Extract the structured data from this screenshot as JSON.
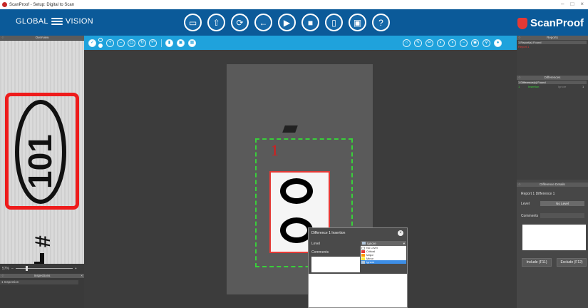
{
  "window": {
    "title": "ScanProof - Setup: Digital to Scan"
  },
  "toolbar": {
    "brand": "GLOBAL",
    "brand2": "VISION",
    "product": "ScanProof",
    "buttons": [
      {
        "icon": "folder-icon",
        "glyph": "▭"
      },
      {
        "icon": "upload-icon",
        "glyph": "⇧"
      },
      {
        "icon": "refresh-icon",
        "glyph": "⟳"
      },
      {
        "icon": "back-icon",
        "glyph": "←"
      },
      {
        "icon": "play-icon",
        "glyph": "▶"
      },
      {
        "icon": "stop-icon",
        "glyph": "■"
      },
      {
        "icon": "document-icon",
        "glyph": "▯"
      },
      {
        "icon": "screens-icon",
        "glyph": "▣"
      },
      {
        "icon": "help-icon",
        "glyph": "?"
      }
    ]
  },
  "overview": {
    "title": "Overview",
    "zoom": "57%"
  },
  "inspections": {
    "title": "Inspections",
    "item": "1 Inspection"
  },
  "viewer": {
    "difference_number": "1"
  },
  "popup": {
    "title": "Difference 1 Insertion",
    "level_label": "Level",
    "level_value": "Ignore",
    "comments_label": "Comments",
    "options": [
      {
        "label": "No Level",
        "color": "#ffffff"
      },
      {
        "label": "Critical",
        "color": "#e53935"
      },
      {
        "label": "Major",
        "color": "#ff9800"
      },
      {
        "label": "Minor",
        "color": "#ffeb3b"
      },
      {
        "label": "Ignore",
        "color": "#b0c4d8",
        "selected": true
      }
    ]
  },
  "right_panel": {
    "reports_title": "Reports",
    "reports_found": "1 Report(s) Found",
    "reports_item": "Report 1",
    "differences_title": "Differences",
    "differences_found": "1 Difference(s) Found",
    "difference_row": {
      "num": "1",
      "type": "Insertion",
      "level": "Ignore",
      "page": "1"
    },
    "details_title": "Difference Details",
    "details_heading": "Report 1 Difference 1",
    "level_label": "Level",
    "level_value": "No Level",
    "comments_label": "Comments",
    "include_btn": "Include (F11)",
    "exclude_btn": "Exclude (F12)"
  },
  "colors": {
    "toolbar": "#0b5a99",
    "viewer_toolbar": "#1fa2dc",
    "accent_red": "#e53935",
    "diff_box": "#39d03a"
  }
}
